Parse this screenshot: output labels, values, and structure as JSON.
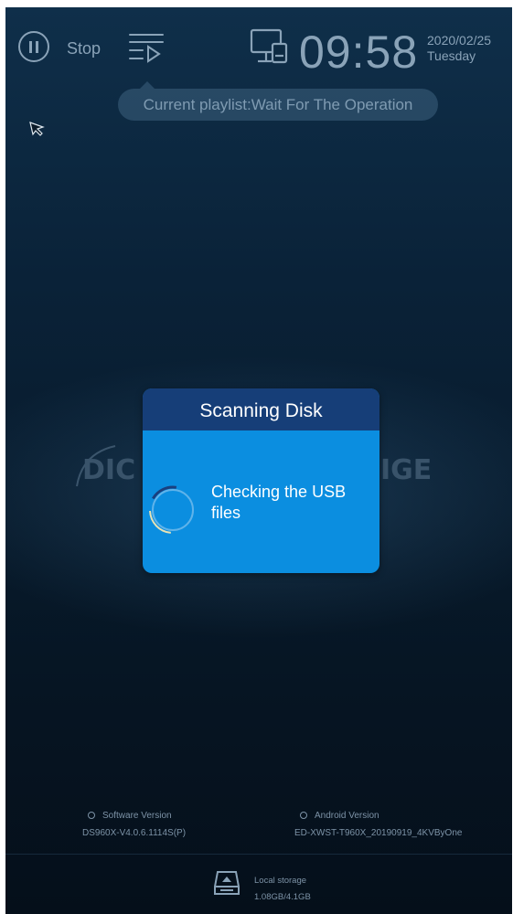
{
  "topbar": {
    "stop_label": "Stop",
    "time": "09:58",
    "date": "2020/02/25",
    "weekday": "Tuesday",
    "icons": [
      "pause-icon",
      "playlist-icon",
      "monitor-icon"
    ]
  },
  "playlist_status": "Current playlist:Wait For The Operation",
  "logo": {
    "left": "DIC",
    "right": "IGE"
  },
  "dialog": {
    "title": "Scanning Disk",
    "message": "Checking the USB files"
  },
  "versions": {
    "software_label": "Software Version",
    "software_value": "DS960X-V4.0.6.1114S(P)",
    "android_label": "Android Version",
    "android_value": "ED-XWST-T960X_20190919_4KVByOne"
  },
  "storage": {
    "label": "Local storage",
    "usage": "1.08GB/4.1GB"
  },
  "colors": {
    "dialog_header": "#163e78",
    "dialog_body": "#0b8ee0",
    "background_top": "#0f2f4a",
    "background_bottom": "#050f1a",
    "muted_text": "#8aa3b8"
  }
}
